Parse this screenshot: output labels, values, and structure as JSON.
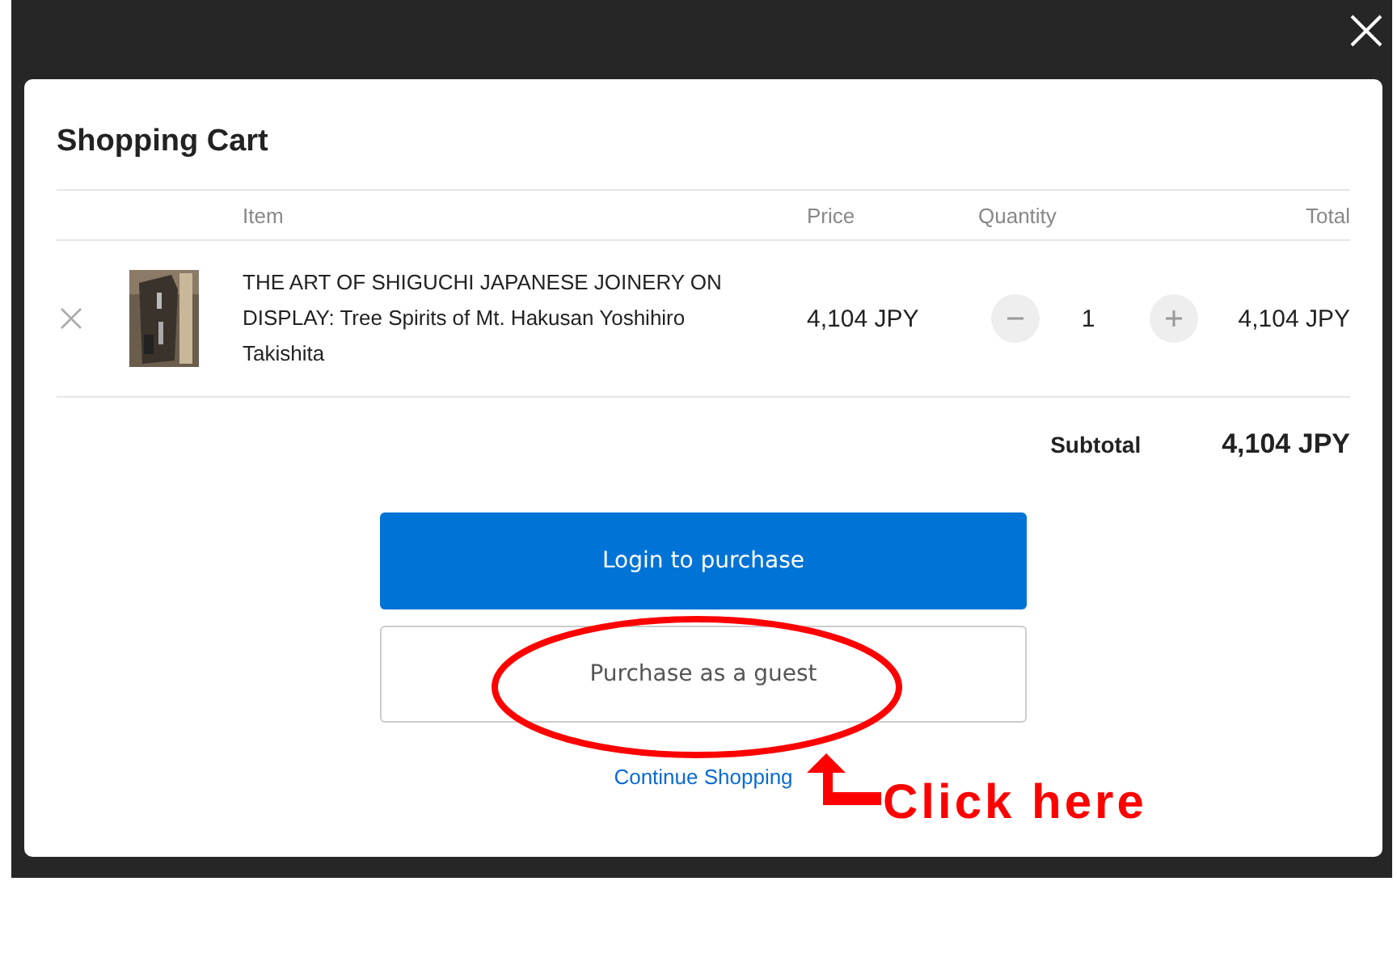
{
  "modal": {
    "title": "Shopping Cart",
    "columns": [
      "Item",
      "Price",
      "Quantity",
      "Total"
    ],
    "items": [
      {
        "title": "THE ART OF SHIGUCHI JAPANESE JOINERY ON DISPLAY: Tree Spirits of Mt. Hakusan Yoshihiro Takishita",
        "price": "4,104 JPY",
        "quantity": "1",
        "total": "4,104 JPY"
      }
    ],
    "subtotal_label": "Subtotal",
    "subtotal": "4,104 JPY",
    "buttons": [
      {
        "label": "Login to purchase",
        "kind": "primary"
      },
      {
        "label": "Purchase as a guest",
        "kind": "secondary"
      }
    ],
    "continue_link": "Continue Shopping"
  },
  "annotation": {
    "label": "Click here"
  }
}
